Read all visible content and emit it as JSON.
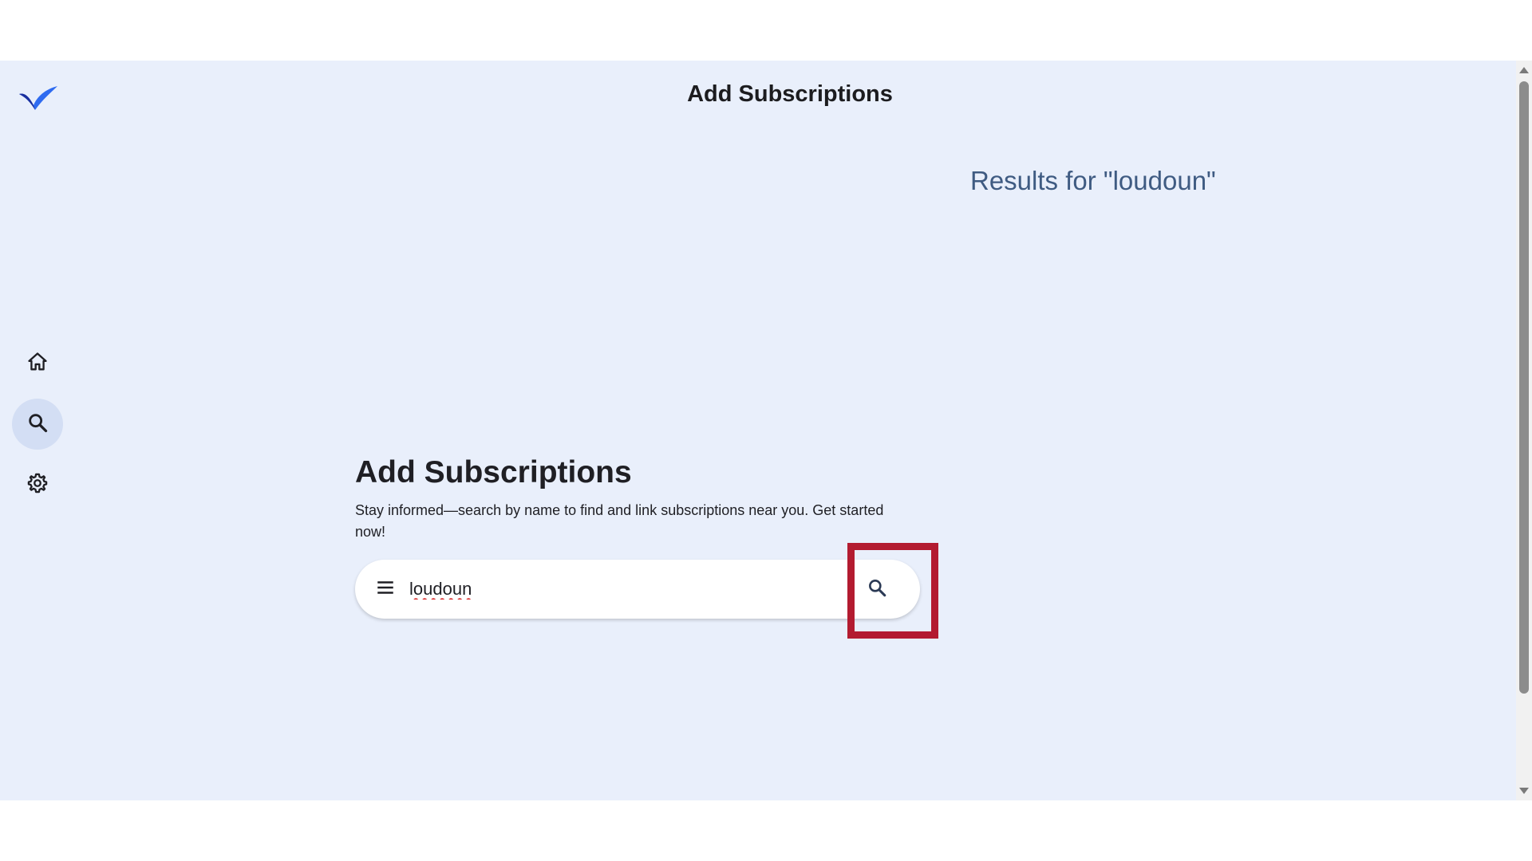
{
  "header": {
    "title": "Add Subscriptions",
    "logo_icon": "checkmark-logo-icon",
    "brand_colors": [
      "#1a2f9e",
      "#2f6bf0"
    ]
  },
  "nav": {
    "items": [
      {
        "name": "home",
        "icon": "home-icon",
        "active": false
      },
      {
        "name": "search",
        "icon": "search-icon",
        "active": true
      },
      {
        "name": "settings",
        "icon": "gear-icon",
        "active": false
      }
    ]
  },
  "results": {
    "heading": "Results for \"loudoun\""
  },
  "main": {
    "title": "Add Subscriptions",
    "description": "Stay informed—search by name to find and link subscriptions near you. Get started now!"
  },
  "search": {
    "value": "loudoun",
    "menu_icon": "menu-icon",
    "submit_icon": "search-icon"
  },
  "annotation": {
    "highlight_color": "#b31b30"
  },
  "colors": {
    "background": "#e9effb",
    "active_nav": "#d3def4",
    "results_text": "#3f5b82"
  }
}
